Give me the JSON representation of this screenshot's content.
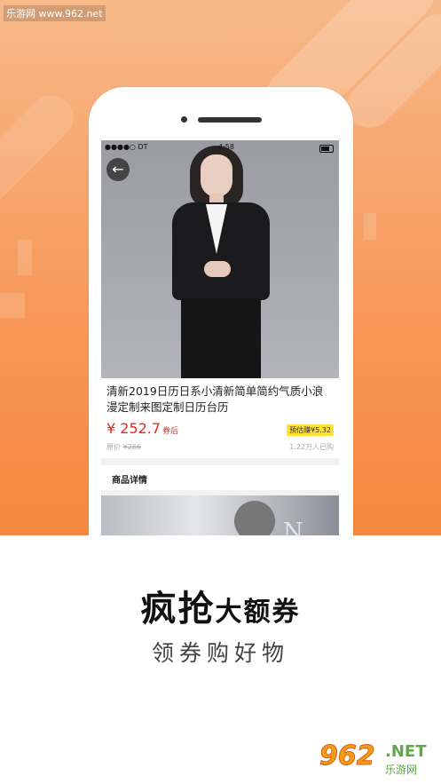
{
  "watermark": "乐游网 www.962.net",
  "statusbar": {
    "carrier": "●●●●○ DT",
    "time": "4:58"
  },
  "product": {
    "title": "清新2019日历日系小清新简单简约气质小浪漫定制来图定制日历台历",
    "price": "¥ 252.7",
    "price_tag": "券后",
    "earn": "预估赚¥5.32",
    "orig_label": "原价",
    "orig_price": "¥266",
    "sold": "1.22万人已购"
  },
  "detail": {
    "title": "商品详情",
    "image_text": "N"
  },
  "promo": {
    "big1": "疯抢",
    "small1": "大额券",
    "sub": "领券购好物"
  },
  "logo": {
    "num": "962",
    "net": ".NET",
    "cn": "乐游网"
  }
}
